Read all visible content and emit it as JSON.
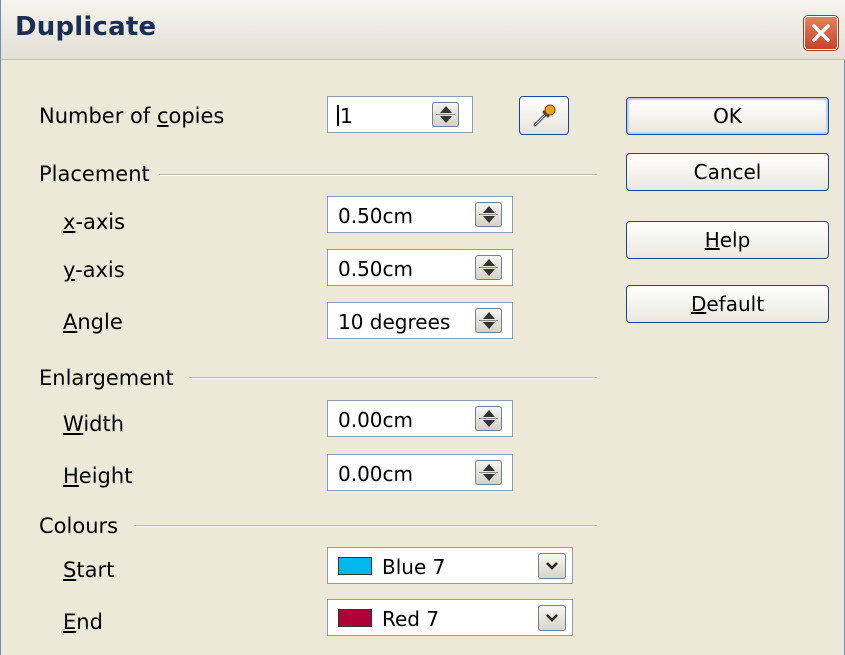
{
  "window": {
    "title": "Duplicate"
  },
  "copies": {
    "label_pre": "Number of ",
    "label_mn": "c",
    "label_post": "opies",
    "value": "1"
  },
  "placement": {
    "heading": "Placement",
    "x_axis": {
      "label_mn": "x",
      "label_post": "-axis",
      "value": "0.50cm"
    },
    "y_axis": {
      "label_mn": "y",
      "label_post": "-axis",
      "value": "0.50cm"
    },
    "angle": {
      "label_mn": "A",
      "label_post": "ngle",
      "value": "10 degrees"
    }
  },
  "enlargement": {
    "heading": "Enlargement",
    "width": {
      "label_mn": "W",
      "label_post": "idth",
      "value": "0.00cm"
    },
    "height": {
      "label_mn": "H",
      "label_post": "eight",
      "value": "0.00cm"
    }
  },
  "colours": {
    "heading": "Colours",
    "start": {
      "label_mn": "S",
      "label_post": "tart",
      "value": "Blue 7",
      "swatch": "#00b8f0"
    },
    "end": {
      "label_mn": "E",
      "label_post": "nd",
      "value": "Red 7",
      "swatch": "#b0003a"
    }
  },
  "buttons": {
    "ok": "OK",
    "cancel": "Cancel",
    "help_mn": "H",
    "help_post": "elp",
    "default_mn": "D",
    "default_post": "efault"
  },
  "icons": {
    "close": "close-icon",
    "pick": "eyedropper-icon",
    "spin": "spin-arrows-icon",
    "dropdown": "chevron-down-icon"
  }
}
